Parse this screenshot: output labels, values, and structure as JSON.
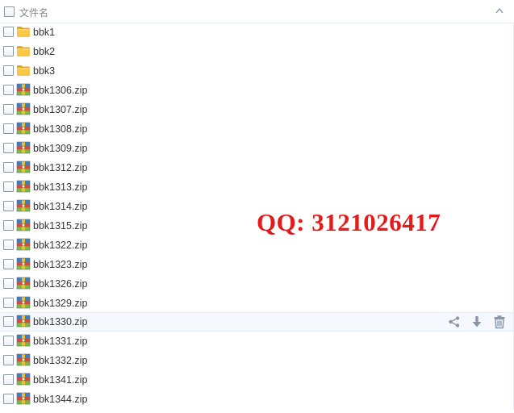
{
  "header": {
    "column_label": "文件名"
  },
  "files": [
    {
      "name": "bbk1",
      "type": "folder"
    },
    {
      "name": "bbk2",
      "type": "folder"
    },
    {
      "name": "bbk3",
      "type": "folder"
    },
    {
      "name": "bbk1306.zip",
      "type": "zip"
    },
    {
      "name": "bbk1307.zip",
      "type": "zip"
    },
    {
      "name": "bbk1308.zip",
      "type": "zip"
    },
    {
      "name": "bbk1309.zip",
      "type": "zip"
    },
    {
      "name": "bbk1312.zip",
      "type": "zip"
    },
    {
      "name": "bbk1313.zip",
      "type": "zip"
    },
    {
      "name": "bbk1314.zip",
      "type": "zip"
    },
    {
      "name": "bbk1315.zip",
      "type": "zip"
    },
    {
      "name": "bbk1322.zip",
      "type": "zip"
    },
    {
      "name": "bbk1323.zip",
      "type": "zip"
    },
    {
      "name": "bbk1326.zip",
      "type": "zip"
    },
    {
      "name": "bbk1329.zip",
      "type": "zip"
    },
    {
      "name": "bbk1330.zip",
      "type": "zip",
      "hovered": true
    },
    {
      "name": "bbk1331.zip",
      "type": "zip"
    },
    {
      "name": "bbk1332.zip",
      "type": "zip"
    },
    {
      "name": "bbk1341.zip",
      "type": "zip"
    },
    {
      "name": "bbk1344.zip",
      "type": "zip"
    }
  ],
  "row_actions": [
    "share-icon",
    "download-icon",
    "trash-icon"
  ],
  "watermark": {
    "text": "QQ: 3121026417",
    "color": "#e31b1b"
  },
  "colors": {
    "folder": "#f5b933",
    "hover_bg": "#f5f9fd",
    "icon_gray": "#8a97a6"
  }
}
